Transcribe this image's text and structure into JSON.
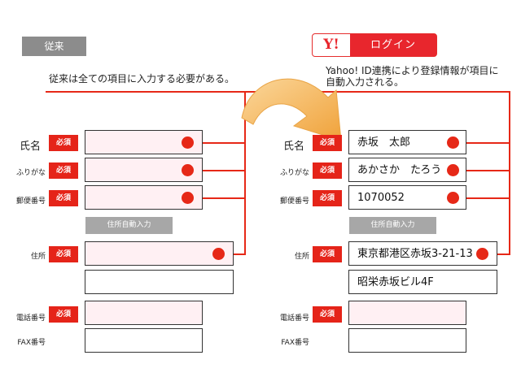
{
  "left": {
    "badge": "従来",
    "description": "従来は全ての項目に入力する必要がある。",
    "fields": {
      "name_label": "氏名",
      "furigana_label": "ふりがな",
      "postal_label": "郵便番号",
      "address_label": "住所",
      "phone_label": "電話番号",
      "fax_label": "FAX番号"
    },
    "required": "必須",
    "auto_address_button": "住所自動入力"
  },
  "right": {
    "yahoo_logo": "Y!",
    "login_label": "ログイン",
    "description_line1": "Yahoo! ID連携により登録情報が項目に",
    "description_line2": "自動入力される。",
    "fields": {
      "name_label": "氏名",
      "furigana_label": "ふりがな",
      "postal_label": "郵便番号",
      "address_label": "住所",
      "phone_label": "電話番号",
      "fax_label": "FAX番号"
    },
    "values": {
      "name": "赤坂　太郎",
      "furigana": "あかさか　たろう",
      "postal": "1070052",
      "address1": "東京都港区赤坂3-21-13",
      "address2": "昭栄赤坂ビル4F"
    },
    "required": "必須",
    "auto_address_button": "住所自動入力"
  },
  "colors": {
    "accent_red": "#e62817",
    "field_pink": "#fff0f3",
    "badge_gray": "#8c8c8c",
    "arrow_orange": "#f0a23a"
  }
}
